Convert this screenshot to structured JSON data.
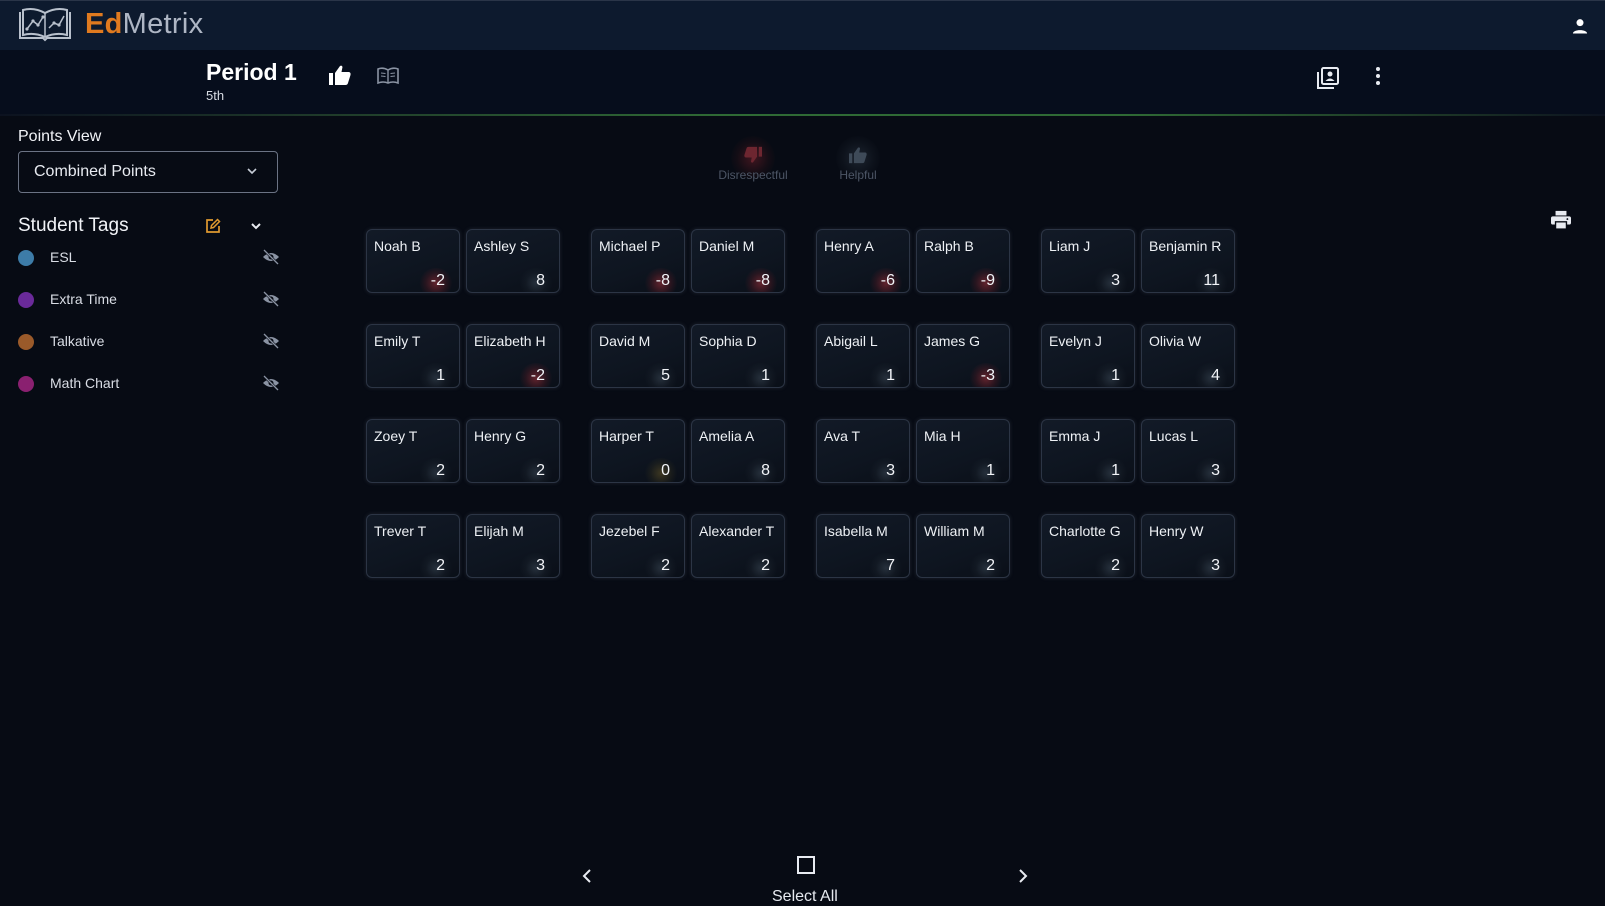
{
  "app": {
    "brand_ed": "Ed",
    "brand_metrix": "Metrix",
    "brand_color": "#e07a1f"
  },
  "header": {
    "period_title": "Period 1",
    "period_subtitle": "5th"
  },
  "sidebar": {
    "points_view_label": "Points View",
    "points_view_value": "Combined Points",
    "student_tags_label": "Student Tags",
    "tags": [
      {
        "name": "ESL",
        "color": "#3d7ca8"
      },
      {
        "name": "Extra Time",
        "color": "#6a2a9a"
      },
      {
        "name": "Talkative",
        "color": "#9a5a2a"
      },
      {
        "name": "Math Chart",
        "color": "#8a2070"
      }
    ]
  },
  "behaviors": [
    {
      "label": "Disrespectful",
      "icon": "thumb-down-icon",
      "color": "#7a2830"
    },
    {
      "label": "Helpful",
      "icon": "thumb-up-icon",
      "color": "#3e4a58"
    }
  ],
  "students": [
    {
      "name": "Noah B",
      "points": "-2"
    },
    {
      "name": "Ashley S",
      "points": "8"
    },
    {
      "name": "Michael P",
      "points": "-8"
    },
    {
      "name": "Daniel M",
      "points": "-8"
    },
    {
      "name": "Henry A",
      "points": "-6"
    },
    {
      "name": "Ralph B",
      "points": "-9"
    },
    {
      "name": "Liam J",
      "points": "3"
    },
    {
      "name": "Benjamin R",
      "points": "11"
    },
    {
      "name": "Emily T",
      "points": "1"
    },
    {
      "name": "Elizabeth H",
      "points": "-2"
    },
    {
      "name": "David M",
      "points": "5"
    },
    {
      "name": "Sophia D",
      "points": "1"
    },
    {
      "name": "Abigail L",
      "points": "1"
    },
    {
      "name": "James G",
      "points": "-3"
    },
    {
      "name": "Evelyn J",
      "points": "1"
    },
    {
      "name": "Olivia W",
      "points": "4"
    },
    {
      "name": "Zoey T",
      "points": "2"
    },
    {
      "name": "Henry G",
      "points": "2"
    },
    {
      "name": "Harper T",
      "points": "0"
    },
    {
      "name": "Amelia A",
      "points": "8"
    },
    {
      "name": "Ava T",
      "points": "3"
    },
    {
      "name": "Mia H",
      "points": "1"
    },
    {
      "name": "Emma J",
      "points": "1"
    },
    {
      "name": "Lucas L",
      "points": "3"
    },
    {
      "name": "Trever T",
      "points": "2"
    },
    {
      "name": "Elijah M",
      "points": "3"
    },
    {
      "name": "Jezebel F",
      "points": "2"
    },
    {
      "name": "Alexander T",
      "points": "2"
    },
    {
      "name": "Isabella M",
      "points": "7"
    },
    {
      "name": "William M",
      "points": "2"
    },
    {
      "name": "Charlotte G",
      "points": "2"
    },
    {
      "name": "Henry W",
      "points": "3"
    }
  ],
  "footer": {
    "select_all_label": "Select All"
  }
}
